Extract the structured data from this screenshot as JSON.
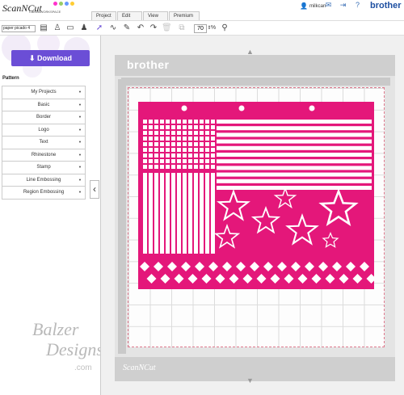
{
  "app": {
    "logo_text": "ScanNCut",
    "logo_sub": "CanvasWORKSPACE",
    "brand": "brother",
    "user_name": "milkcan"
  },
  "tabs": [
    "Project",
    "Edit",
    "View",
    "Premium"
  ],
  "toolbar": {
    "project_name": "paper picado 4",
    "zoom_value": "70",
    "zoom_unit": "%"
  },
  "download_label": "Download",
  "pattern": {
    "title": "Pattern",
    "categories": [
      "My Projects",
      "Basic",
      "Border",
      "Logo",
      "Text",
      "Rhinestone",
      "Stamp",
      "Line Embossing",
      "Region Embossing"
    ],
    "arrow": "▼"
  },
  "mat": {
    "brand_top": "brother",
    "brand_bottom": "ScanNCut"
  },
  "watermark": {
    "line1": "Balzer",
    "line2": "Designs",
    "line3": ".com"
  },
  "colors": {
    "design_pink": "#e4177a",
    "accent_purple": "#6b4ed6",
    "brand_blue": "#1d4fa1"
  }
}
